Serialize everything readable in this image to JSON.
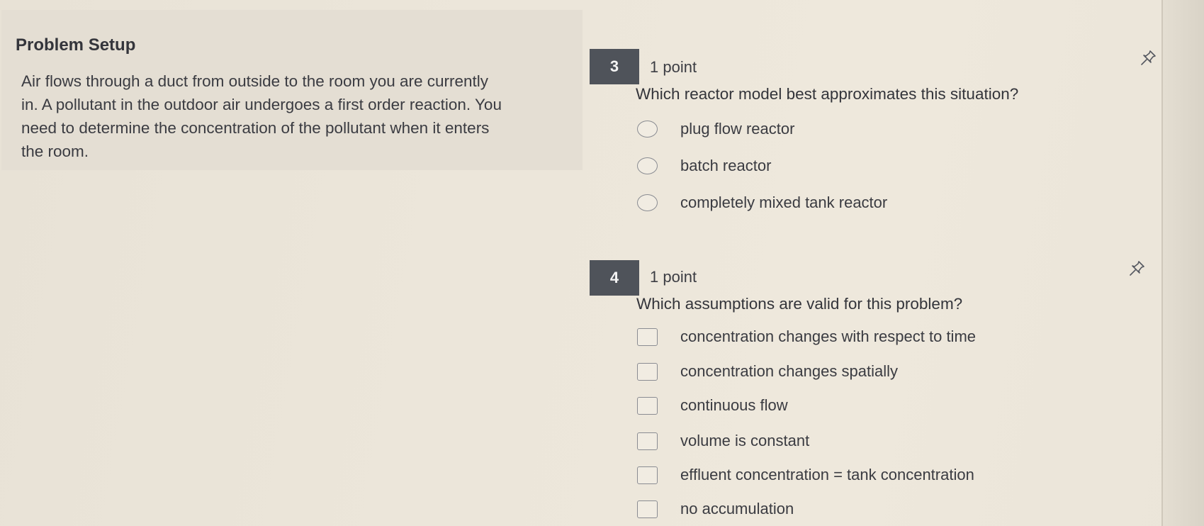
{
  "setup": {
    "title": "Problem Setup",
    "lines": [
      "Air flows through a duct from outside to the room you are currently",
      "in. A pollutant in the outdoor air undergoes a first order reaction. You",
      "need to determine the concentration of the pollutant when it enters",
      "the room."
    ]
  },
  "questions": [
    {
      "number": "3",
      "points": "1 point",
      "prompt": "Which reactor model best approximates this situation?",
      "type": "radio",
      "options": [
        "plug flow reactor",
        "batch reactor",
        "completely mixed tank reactor"
      ]
    },
    {
      "number": "4",
      "points": "1 point",
      "prompt": "Which assumptions are valid for this problem?",
      "type": "checkbox",
      "options": [
        "concentration changes with respect to time",
        "concentration changes spatially",
        "continuous flow",
        "volume is constant",
        "effluent concentration = tank concentration",
        "no accumulation"
      ]
    }
  ],
  "icons": {
    "pin": "pin-icon"
  },
  "colors": {
    "badge": "#4f535a",
    "background": "#ece6da",
    "panel": "#e4ded3"
  }
}
